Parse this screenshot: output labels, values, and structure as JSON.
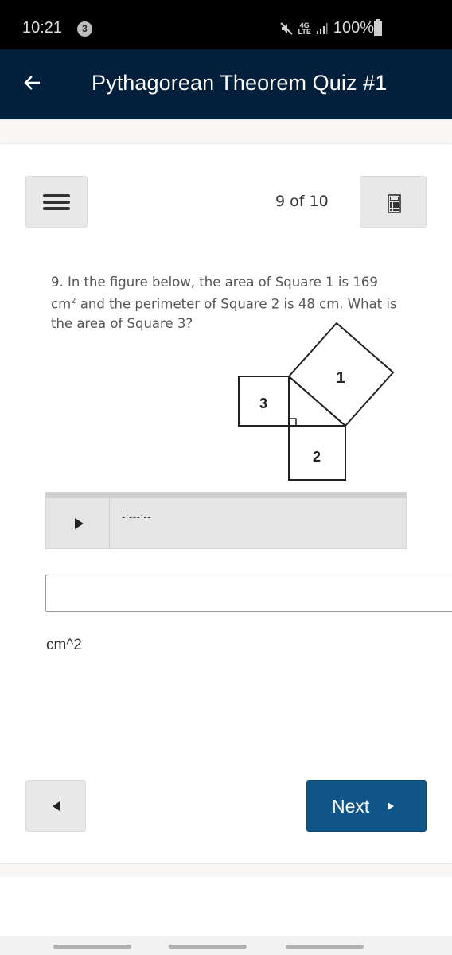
{
  "status_bar": {
    "time": "10:21",
    "notification_count": "3",
    "network": "4G LTE",
    "battery": "100%",
    "icons": [
      "mute-icon",
      "network-4g-icon",
      "signal-icon",
      "battery-icon"
    ]
  },
  "header": {
    "back_icon": "arrow-left-icon",
    "title": "Pythagorean Theorem Quiz #1"
  },
  "toolbar": {
    "menu_icon": "hamburger-menu-icon",
    "progress": "9 of 10",
    "calculator_icon": "calculator-icon"
  },
  "question": {
    "text_before_sup": "9. In the figure below, the area of Square 1 is 169 cm",
    "sup": "2",
    "text_after_sup": " and the perimeter of Square 2 is 48 cm. What is the area of Square 3?"
  },
  "figure": {
    "square_labels": {
      "square1": "1",
      "square2": "2",
      "square3": "3"
    }
  },
  "audio": {
    "play_icon": "play-icon",
    "time": "-:---:--"
  },
  "answer": {
    "value": "",
    "placeholder": "",
    "unit": "cm^2"
  },
  "navigation": {
    "prev_icon": "triangle-left-icon",
    "next_label": "Next",
    "next_icon": "triangle-right-icon"
  },
  "colors": {
    "header_bg": "#02203b",
    "next_button_bg": "#0f5587",
    "grey_button_bg": "#e8e8e8"
  }
}
